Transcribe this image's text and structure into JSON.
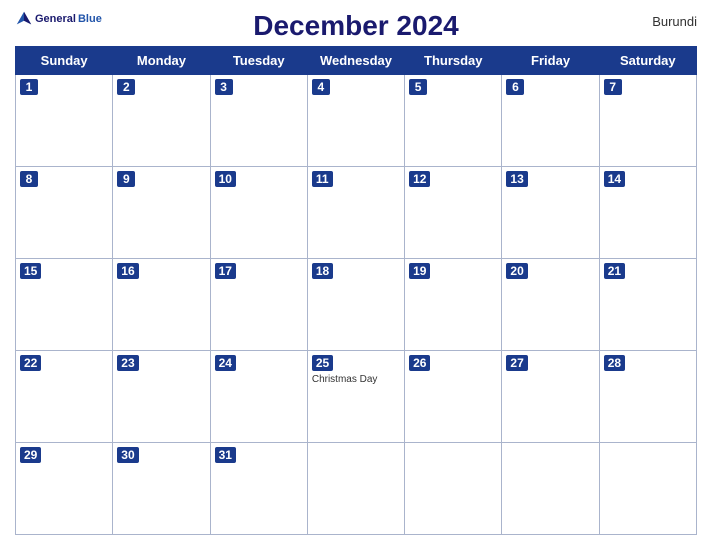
{
  "header": {
    "logo": {
      "general": "General",
      "blue": "Blue",
      "bird_unicode": "▲"
    },
    "title": "December 2024",
    "country": "Burundi"
  },
  "days_of_week": [
    "Sunday",
    "Monday",
    "Tuesday",
    "Wednesday",
    "Thursday",
    "Friday",
    "Saturday"
  ],
  "weeks": [
    [
      {
        "date": "1",
        "events": []
      },
      {
        "date": "2",
        "events": []
      },
      {
        "date": "3",
        "events": []
      },
      {
        "date": "4",
        "events": []
      },
      {
        "date": "5",
        "events": []
      },
      {
        "date": "6",
        "events": []
      },
      {
        "date": "7",
        "events": []
      }
    ],
    [
      {
        "date": "8",
        "events": []
      },
      {
        "date": "9",
        "events": []
      },
      {
        "date": "10",
        "events": []
      },
      {
        "date": "11",
        "events": []
      },
      {
        "date": "12",
        "events": []
      },
      {
        "date": "13",
        "events": []
      },
      {
        "date": "14",
        "events": []
      }
    ],
    [
      {
        "date": "15",
        "events": []
      },
      {
        "date": "16",
        "events": []
      },
      {
        "date": "17",
        "events": []
      },
      {
        "date": "18",
        "events": []
      },
      {
        "date": "19",
        "events": []
      },
      {
        "date": "20",
        "events": []
      },
      {
        "date": "21",
        "events": []
      }
    ],
    [
      {
        "date": "22",
        "events": []
      },
      {
        "date": "23",
        "events": []
      },
      {
        "date": "24",
        "events": []
      },
      {
        "date": "25",
        "events": [
          "Christmas Day"
        ]
      },
      {
        "date": "26",
        "events": []
      },
      {
        "date": "27",
        "events": []
      },
      {
        "date": "28",
        "events": []
      }
    ],
    [
      {
        "date": "29",
        "events": []
      },
      {
        "date": "30",
        "events": []
      },
      {
        "date": "31",
        "events": []
      },
      {
        "date": "",
        "events": []
      },
      {
        "date": "",
        "events": []
      },
      {
        "date": "",
        "events": []
      },
      {
        "date": "",
        "events": []
      }
    ]
  ]
}
